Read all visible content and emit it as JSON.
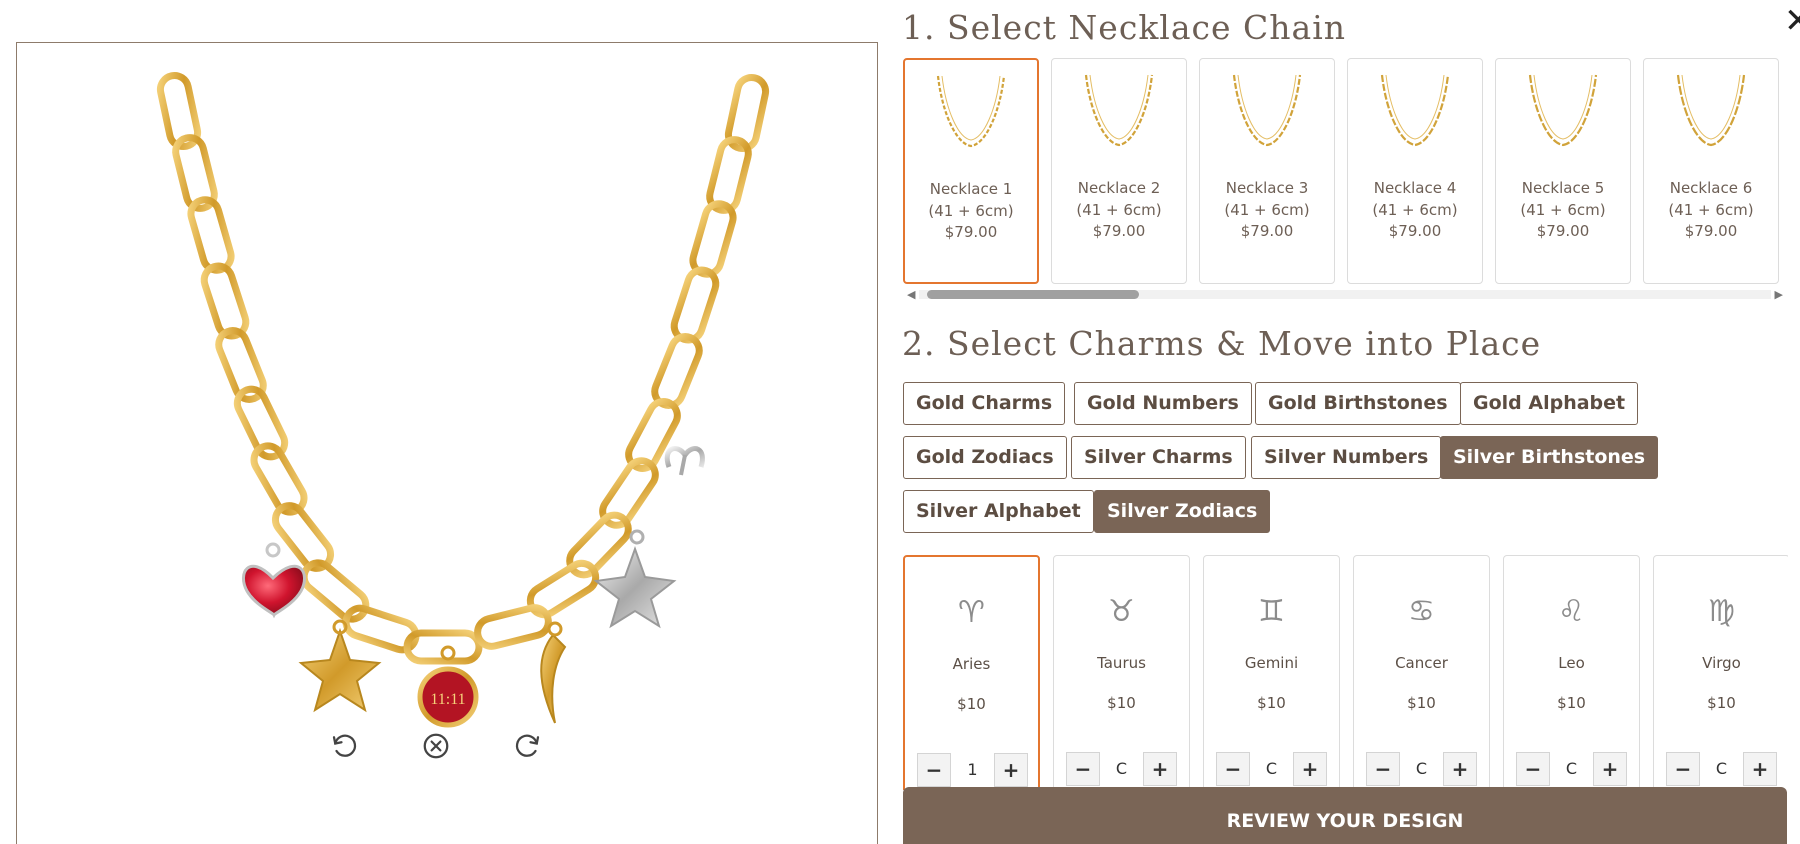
{
  "sections": {
    "chain_title": "1. Select Necklace Chain",
    "charms_title": "2. Select Charms & Move into Place"
  },
  "close_label": "✕",
  "chains": [
    {
      "name": "Necklace 1 (41 + 6cm)",
      "price": "$79.00",
      "selected": true
    },
    {
      "name": "Necklace 2 (41 + 6cm)",
      "price": "$79.00",
      "selected": false
    },
    {
      "name": "Necklace 3 (41 + 6cm)",
      "price": "$79.00",
      "selected": false
    },
    {
      "name": "Necklace 4 (41 + 6cm)",
      "price": "$79.00",
      "selected": false
    },
    {
      "name": "Necklace 5 (41 + 6cm)",
      "price": "$79.00",
      "selected": false
    },
    {
      "name": "Necklace 6 (41 + 6cm)",
      "price": "$79.00",
      "selected": false
    }
  ],
  "categories": [
    {
      "label": "Gold Charms",
      "active": false
    },
    {
      "label": "Gold Numbers",
      "active": false
    },
    {
      "label": "Gold Birthstones",
      "active": false
    },
    {
      "label": "Gold Alphabet",
      "active": false
    },
    {
      "label": "Gold Zodiacs",
      "active": false
    },
    {
      "label": "Silver Charms",
      "active": false
    },
    {
      "label": "Silver Numbers",
      "active": false
    },
    {
      "label": "Silver Birthstones",
      "active": true
    },
    {
      "label": "Silver Alphabet",
      "active": false
    },
    {
      "label": "Silver Zodiacs",
      "active": true
    }
  ],
  "charms": [
    {
      "name": "Aries",
      "price": "$10",
      "qty": "1",
      "glyph": "♈",
      "selected": true
    },
    {
      "name": "Taurus",
      "price": "$10",
      "qty": "C",
      "glyph": "♉",
      "selected": false
    },
    {
      "name": "Gemini",
      "price": "$10",
      "qty": "C",
      "glyph": "♊",
      "selected": false
    },
    {
      "name": "Cancer",
      "price": "$10",
      "qty": "C",
      "glyph": "♋",
      "selected": false
    },
    {
      "name": "Leo",
      "price": "$10",
      "qty": "C",
      "glyph": "♌",
      "selected": false
    },
    {
      "name": "Virgo",
      "price": "$10",
      "qty": "C",
      "glyph": "♍",
      "selected": false
    }
  ],
  "qty_minus": "−",
  "qty_plus": "+",
  "review_label": "REVIEW YOUR DESIGN",
  "preview": {
    "coin_text": "11:11",
    "tools": [
      "undo-icon",
      "clear-icon",
      "redo-icon"
    ]
  },
  "colors": {
    "accent": "#e4762f",
    "brand": "#7a6556",
    "gold": "#d9a93b",
    "ruby": "#c8192f"
  }
}
